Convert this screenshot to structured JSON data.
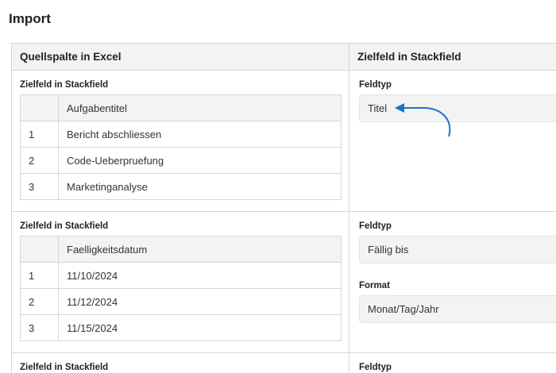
{
  "page": {
    "title": "Import"
  },
  "table": {
    "headers": {
      "left": "Quellspalte in Excel",
      "right": "Zielfeld in Stackfield"
    },
    "rows": [
      {
        "left_label": "Zielfeld in Stackfield",
        "column_header": "Aufgabentitel",
        "preview": [
          {
            "index": "1",
            "value": "Bericht abschliessen"
          },
          {
            "index": "2",
            "value": "Code-Ueberpruefung"
          },
          {
            "index": "3",
            "value": "Marketinganalyse"
          }
        ],
        "field_type_label": "Feldtyp",
        "field_type_value": "Titel"
      },
      {
        "left_label": "Zielfeld in Stackfield",
        "column_header": "Faelligkeitsdatum",
        "preview": [
          {
            "index": "1",
            "value": "11/10/2024"
          },
          {
            "index": "2",
            "value": "11/12/2024"
          },
          {
            "index": "3",
            "value": "11/15/2024"
          }
        ],
        "field_type_label": "Feldtyp",
        "field_type_value": "Fällig bis",
        "format_label": "Format",
        "format_value": "Monat/Tag/Jahr"
      },
      {
        "left_label": "Zielfeld in Stackfield",
        "field_type_label": "Feldtyp"
      }
    ]
  },
  "colors": {
    "arrow": "#1a73c8",
    "border": "#d6d6d6",
    "header_bg": "#f3f3f3"
  },
  "icons": {
    "pointer": "curved-arrow-icon"
  }
}
